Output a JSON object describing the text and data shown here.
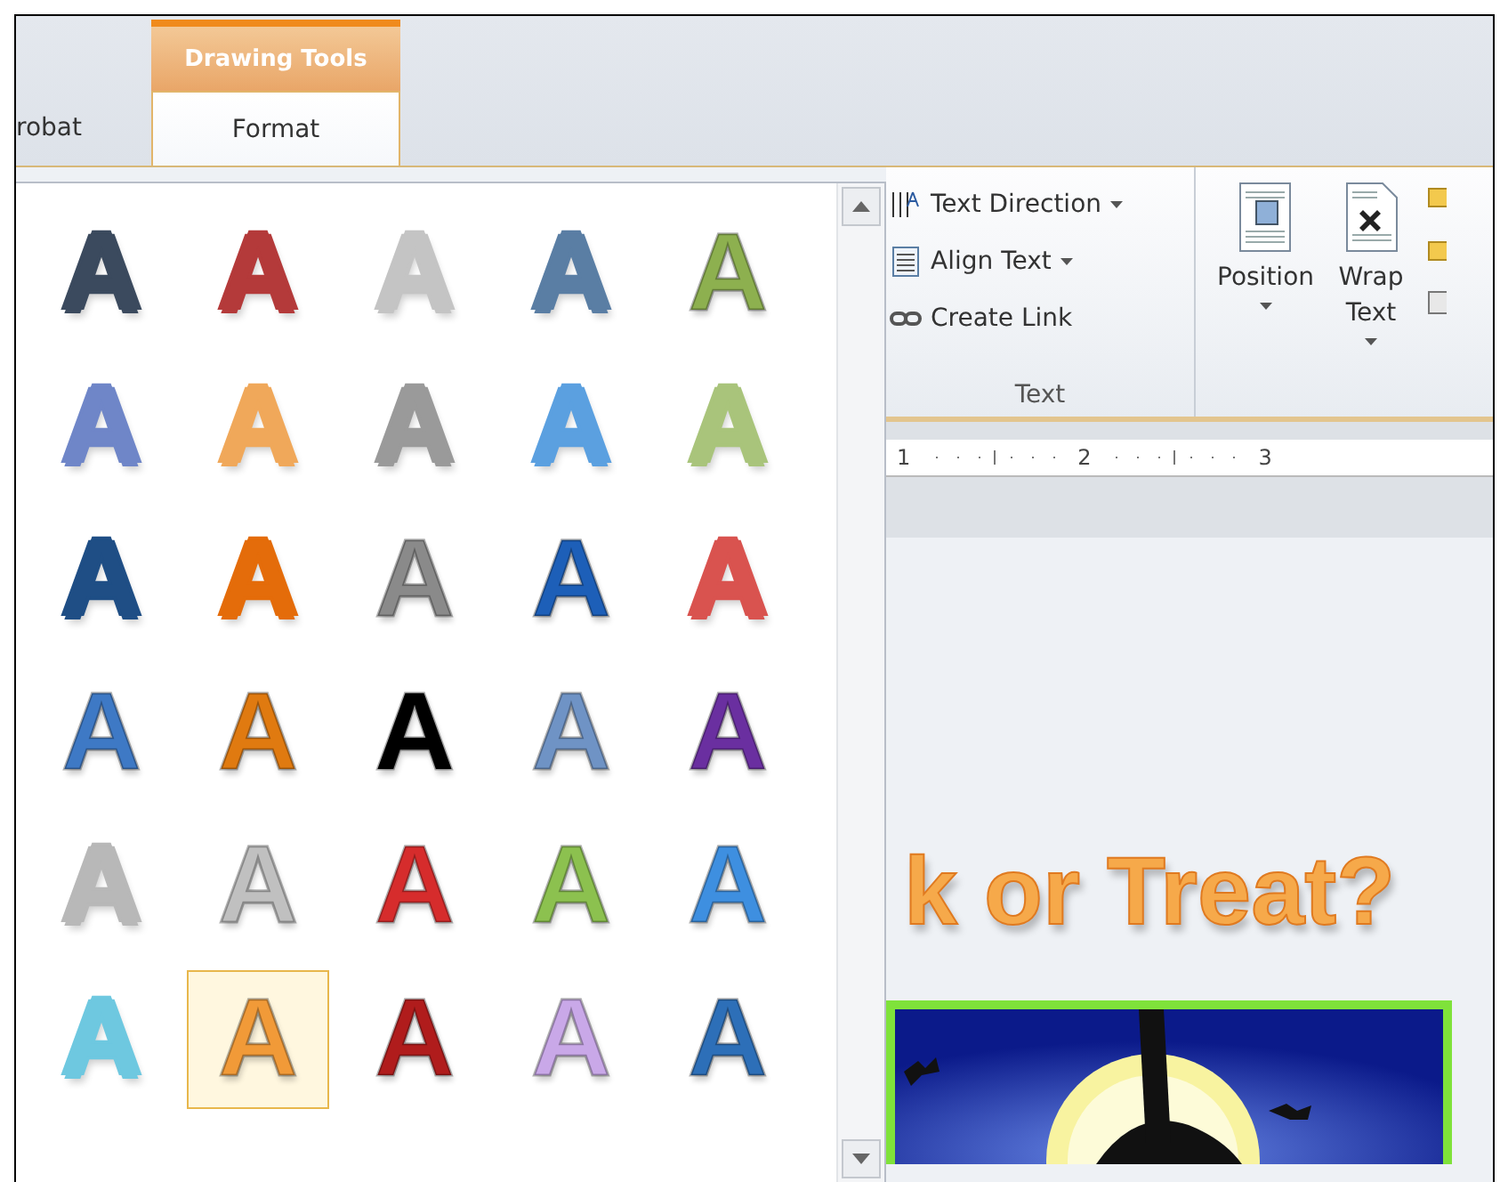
{
  "tabs": [
    {
      "label": "robat",
      "selected": false
    },
    {
      "label": "Format",
      "selected": true
    }
  ],
  "contextual_header": "Drawing Tools",
  "gallery": {
    "items": [
      {
        "letter": "A",
        "kind": "outline",
        "color": "#3b4a5e",
        "selected": false
      },
      {
        "letter": "A",
        "kind": "outline",
        "color": "#b43a3a",
        "selected": false
      },
      {
        "letter": "A",
        "kind": "outline",
        "color": "#c4c4c4",
        "selected": false
      },
      {
        "letter": "A",
        "kind": "outline",
        "color": "#5a7ea4",
        "selected": false
      },
      {
        "letter": "A",
        "kind": "solid",
        "color": "#8db04f",
        "selected": false
      },
      {
        "letter": "A",
        "kind": "outline",
        "color": "#6f86c8",
        "selected": false
      },
      {
        "letter": "A",
        "kind": "outline",
        "color": "#f0a85a",
        "selected": false
      },
      {
        "letter": "A",
        "kind": "outline",
        "color": "#9a9a9a",
        "selected": false
      },
      {
        "letter": "A",
        "kind": "outline",
        "color": "#5ba0e0",
        "selected": false
      },
      {
        "letter": "A",
        "kind": "outline",
        "color": "#a9c47b",
        "selected": false
      },
      {
        "letter": "A",
        "kind": "outline",
        "color": "#1f4e85",
        "selected": false
      },
      {
        "letter": "A",
        "kind": "outline",
        "color": "#e46c0a",
        "selected": false
      },
      {
        "letter": "A",
        "kind": "solid",
        "color": "#8a8a8a",
        "selected": false
      },
      {
        "letter": "A",
        "kind": "solid",
        "color": "#1d5fb8",
        "selected": false
      },
      {
        "letter": "A",
        "kind": "outline",
        "color": "#d9534f",
        "selected": false
      },
      {
        "letter": "A",
        "kind": "solid",
        "color": "#3e79c5",
        "selected": false
      },
      {
        "letter": "A",
        "kind": "solid",
        "color": "#e07a10",
        "selected": false
      },
      {
        "letter": "A",
        "kind": "solid",
        "color": "#000000",
        "selected": false
      },
      {
        "letter": "A",
        "kind": "solid",
        "color": "#6f93c5",
        "selected": false
      },
      {
        "letter": "A",
        "kind": "solid",
        "color": "#6a2fa0",
        "selected": false
      },
      {
        "letter": "A",
        "kind": "outline",
        "color": "#b8b8b8",
        "selected": false
      },
      {
        "letter": "A",
        "kind": "solid",
        "color": "#c0c0c0",
        "selected": false
      },
      {
        "letter": "A",
        "kind": "solid",
        "color": "#d62c2c",
        "selected": false
      },
      {
        "letter": "A",
        "kind": "solid",
        "color": "#8cc14f",
        "selected": false
      },
      {
        "letter": "A",
        "kind": "solid",
        "color": "#3e8fe0",
        "selected": false
      },
      {
        "letter": "A",
        "kind": "outline",
        "color": "#6ec8e0",
        "selected": false
      },
      {
        "letter": "A",
        "kind": "solid",
        "color": "#f19a38",
        "selected": true
      },
      {
        "letter": "A",
        "kind": "solid",
        "color": "#b01c1c",
        "selected": false
      },
      {
        "letter": "A",
        "kind": "solid",
        "color": "#c9a8e8",
        "selected": false
      },
      {
        "letter": "A",
        "kind": "solid",
        "color": "#2d6fb8",
        "selected": false
      }
    ]
  },
  "text_group": {
    "buttons": [
      {
        "label": "Text Direction",
        "kind": "direction",
        "dropdown": true
      },
      {
        "label": "Align Text",
        "kind": "align",
        "dropdown": true
      },
      {
        "label": "Create Link",
        "kind": "link",
        "dropdown": false
      }
    ],
    "label": "Text"
  },
  "arrange_group": {
    "buttons": [
      {
        "label": "Position",
        "kind": "position"
      },
      {
        "label": "Wrap Text",
        "kind": "wrap"
      }
    ]
  },
  "ruler": {
    "labels": [
      "1",
      "2",
      "3"
    ]
  },
  "document": {
    "wordart_text": "k or Treat?"
  }
}
